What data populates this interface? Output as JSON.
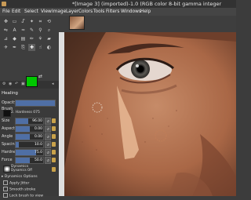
{
  "window": {
    "title": "*[Image 3] (imported)-1.0 (RGB color 8-bit gamma integer"
  },
  "menu": [
    "File",
    "Edit",
    "Select",
    "View",
    "Image",
    "Layer",
    "Colors",
    "Tools",
    "Filters",
    "Windows",
    "Help"
  ],
  "colors": {
    "foreground": "#00c800",
    "background": "#ffffff",
    "selection_fill": "#4f6fa5"
  },
  "tool_options": {
    "title": "Healing",
    "mode_label": "Opacity",
    "opacity_label": "Opacity",
    "brush_label": "Brush",
    "brush_name": "2. Hardness 075",
    "size": {
      "label": "Size",
      "value": "96.00"
    },
    "aspect": {
      "label": "Aspect Ratio",
      "value": "0.00"
    },
    "angle": {
      "label": "Angle",
      "value": "0.00"
    },
    "spacing": {
      "label": "Spacing",
      "value": "10.0"
    },
    "hardness": {
      "label": "Hardness",
      "value": "75.0"
    },
    "force": {
      "label": "Force",
      "value": "50.0"
    },
    "dynamics_label": "Dynamics",
    "dynamics_name": "Dynamics Off",
    "dynamics_options": "Dynamics Options",
    "jitter": "Apply Jitter",
    "smooth": "Smooth stroke",
    "lock": "Lock brush to view"
  },
  "tools": [
    "move-tool",
    "rect-select-tool",
    "lasso-tool",
    "fuzzy-select-tool",
    "crop-tool",
    "transform-tool",
    "flip-tool",
    "text-tool",
    "warp-tool",
    "paths-tool",
    "color-picker-tool",
    "zoom-tool",
    "measure-tool",
    "bucket-fill-tool",
    "gradient-tool",
    "pencil-tool",
    "paintbrush-tool",
    "eraser-tool",
    "airbrush-tool",
    "ink-tool",
    "clone-tool",
    "heal-tool",
    "smudge-tool",
    "dodge-tool"
  ],
  "icons": {
    "app": "gimp-icon",
    "swap": "swap-colors-icon",
    "reset": "default-colors-icon"
  }
}
